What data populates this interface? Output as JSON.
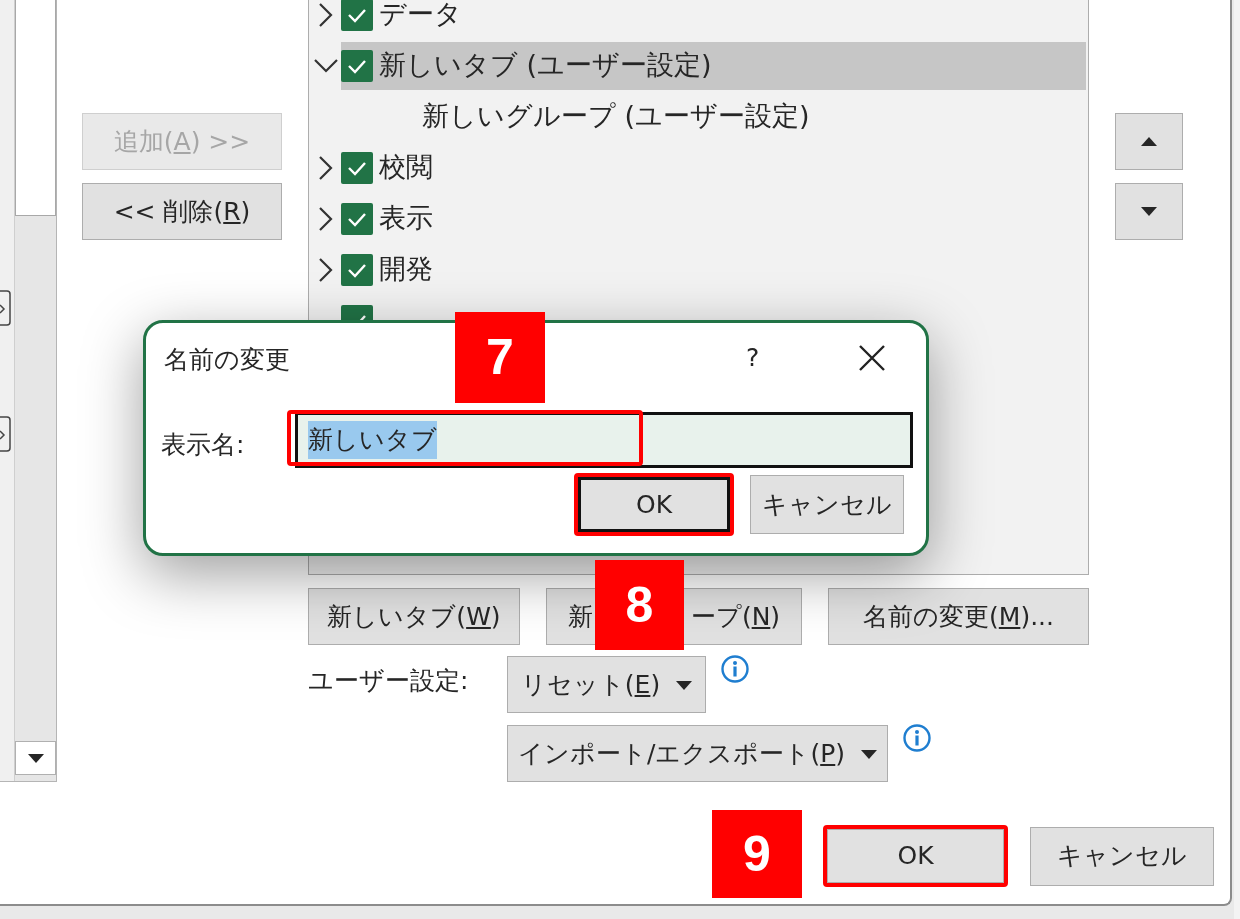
{
  "move_buttons": [
    {
      "before": "追加(",
      "key": "A",
      "after": ") >>",
      "disabled": true
    },
    {
      "before": "<< 削除(",
      "key": "R",
      "after": ")",
      "disabled": false
    }
  ],
  "ribbon_tree": [
    {
      "label": "データ",
      "expanded": false,
      "checked": true,
      "selected": false
    },
    {
      "label": "新しいタブ (ユーザー設定)",
      "expanded": true,
      "checked": true,
      "selected": true,
      "children": [
        {
          "label": "新しいグループ (ユーザー設定)"
        }
      ]
    },
    {
      "label": "校閲",
      "expanded": false,
      "checked": true,
      "selected": false
    },
    {
      "label": "表示",
      "expanded": false,
      "checked": true,
      "selected": false
    },
    {
      "label": "開発",
      "expanded": false,
      "checked": true,
      "selected": false
    },
    {
      "checked": true,
      "selected": false
    }
  ],
  "tree_buttons": [
    {
      "before": "新しいタブ(",
      "key": "W",
      "after": ")"
    },
    {
      "before": "新",
      "before_2": "ープ(",
      "key": "N",
      "after": ")"
    },
    {
      "before": "名前の変更(",
      "key": "M",
      "after": ")..."
    }
  ],
  "customizations": {
    "label": "ユーザー設定:",
    "buttons": [
      {
        "before": "リセット(",
        "key": "E",
        "after": ")"
      },
      {
        "before": "インポート/エクスポート(",
        "key": "P",
        "after": ")"
      }
    ]
  },
  "footer_buttons": [
    {
      "label": "OK",
      "highlighted": true
    },
    {
      "label": "キャンセル",
      "highlighted": false
    }
  ],
  "rename_dialog": {
    "title": "名前の変更",
    "help": "?",
    "field_label": "表示名:",
    "value": "新しいタブ",
    "value_selected": true,
    "value_highlighted": true,
    "buttons": [
      {
        "label": "OK",
        "default": true,
        "highlighted": true
      },
      {
        "label": "キャンセル",
        "default": false,
        "highlighted": false
      }
    ]
  },
  "callouts": [
    {
      "text": "7"
    },
    {
      "text": "8"
    },
    {
      "text": "9"
    }
  ]
}
